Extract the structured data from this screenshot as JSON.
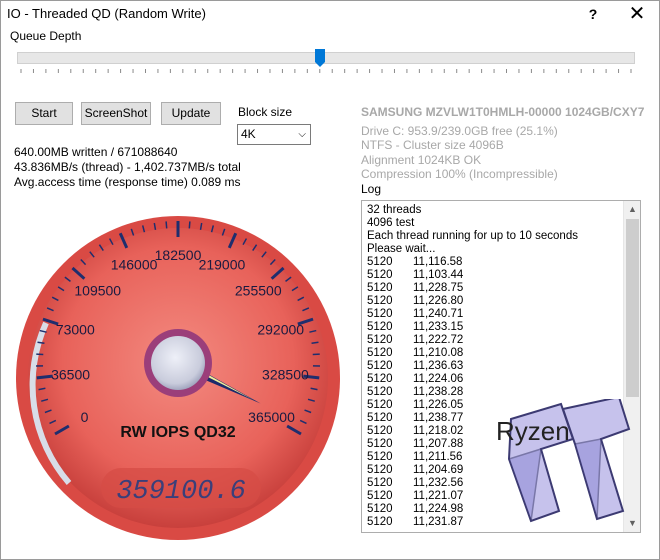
{
  "window": {
    "title": "IO - Threaded QD (Random Write)",
    "help_label": "?",
    "close_label": "✕"
  },
  "controls": {
    "queue_depth_label": "Queue Depth",
    "queue_depth_position": 0.49,
    "start_label": "Start",
    "screenshot_label": "ScreenShot",
    "update_label": "Update",
    "block_size_label": "Block size",
    "block_size_value": "4K"
  },
  "stats": {
    "written": "640.00MB written / 671088640",
    "speed": "43.836MB/s (thread) - 1,402.737MB/s total",
    "access_time": "Avg.access time (response time) 0.089 ms"
  },
  "drive": {
    "model": "SAMSUNG MZVLW1T0HMLH-00000 1024GB/CXY7",
    "free": "Drive C: 953.9/239.0GB free (25.1%)",
    "fs": "NTFS - Cluster size 4096B",
    "alignment": "Alignment 1024KB OK",
    "compression": "Compression 100% (Incompressible)"
  },
  "log": {
    "label": "Log",
    "header_lines": [
      "32 threads",
      "4096 test",
      "Each thread running for up to 10 seconds",
      "Please wait..."
    ],
    "rows": [
      [
        "5120",
        "11,116.58"
      ],
      [
        "5120",
        "11,103.44"
      ],
      [
        "5120",
        "11,228.75"
      ],
      [
        "5120",
        "11,226.80"
      ],
      [
        "5120",
        "11,240.71"
      ],
      [
        "5120",
        "11,233.15"
      ],
      [
        "5120",
        "11,222.72"
      ],
      [
        "5120",
        "11,210.08"
      ],
      [
        "5120",
        "11,236.63"
      ],
      [
        "5120",
        "11,224.06"
      ],
      [
        "5120",
        "11,238.28"
      ],
      [
        "5120",
        "11,226.05"
      ],
      [
        "5120",
        "11,238.77"
      ],
      [
        "5120",
        "11,218.02"
      ],
      [
        "5120",
        "11,207.88"
      ],
      [
        "5120",
        "11,211.56"
      ],
      [
        "5120",
        "11,204.69"
      ],
      [
        "5120",
        "11,232.56"
      ],
      [
        "5120",
        "11,221.07"
      ],
      [
        "5120",
        "11,224.98"
      ],
      [
        "5120",
        "11,231.87"
      ]
    ]
  },
  "gauge": {
    "scale_labels": [
      "0",
      "36500",
      "73000",
      "109500",
      "146000",
      "182500",
      "219000",
      "255500",
      "292000",
      "328500",
      "365000"
    ],
    "max": 365000,
    "value": 359100.6,
    "title": "RW IOPS QD32",
    "digital_readout": "359100.6"
  },
  "watermark": {
    "text": "Ryzen"
  },
  "colors": {
    "gauge_face": "#e8605a",
    "gauge_rim": "#c0393a",
    "needle": "#1b2a6b",
    "scale": "#1f2e6e"
  }
}
